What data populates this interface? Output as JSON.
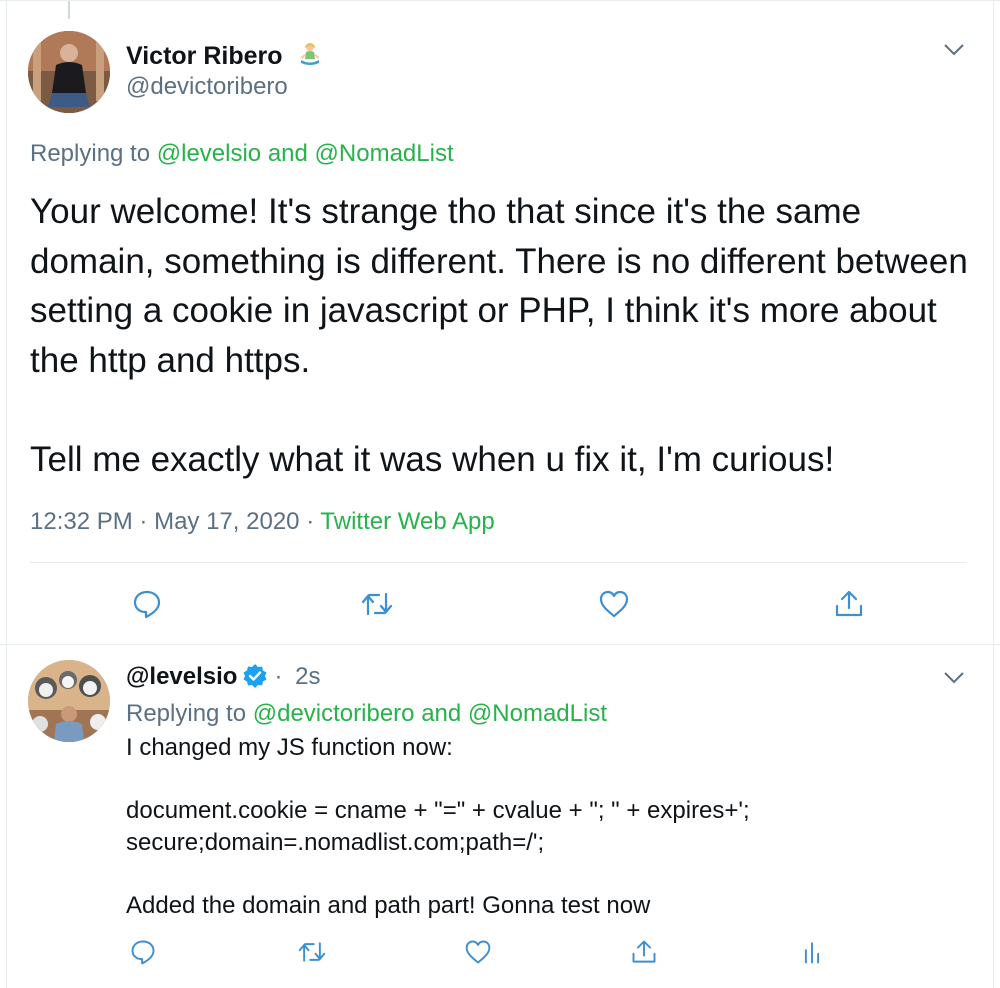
{
  "main_tweet": {
    "author_name": "Victor Ribero",
    "author_handle": "@devictoribero",
    "replying_prefix": "Replying to",
    "replying_user1": "@levelsio",
    "replying_and": "and",
    "replying_user2": "@NomadList",
    "paragraph1": "Your welcome! It's strange tho that since it's the same domain, something is different. There is no different between setting a cookie in javascript or PHP, I think it's more about the http and https.",
    "paragraph2": "Tell me exactly what it was when u fix it, I'm curious!",
    "time": "12:32 PM",
    "dot": "·",
    "date": "May 17, 2020",
    "source": "Twitter Web App",
    "icons": [
      "reply-icon",
      "retweet-icon",
      "like-icon",
      "share-icon",
      "chevron-down-icon",
      "person-meditating-emoji"
    ]
  },
  "reply_tweet": {
    "author_handle": "@levelsio",
    "dot": "·",
    "time_ago": "2s",
    "replying_prefix": "Replying to",
    "replying_user1": "@devictoribero",
    "replying_and": "and",
    "replying_user2": "@NomadList",
    "line1": "I changed my JS function now:",
    "line2": "document.cookie = cname + \"=\" + cvalue + \"; \" + expires+';",
    "line3": "secure;domain=.nomadlist.com;path=/';",
    "line4": "Added the domain and path part! Gonna test now",
    "icons": [
      "reply-icon",
      "retweet-icon",
      "like-icon",
      "share-icon",
      "analytics-icon",
      "verified-badge-icon",
      "chevron-down-icon"
    ]
  },
  "colors": {
    "link": "#26b34a",
    "secondary_text": "#5b7083",
    "icon": "#3d8fd1",
    "verified": "#1da1f2",
    "border": "#e6ecf0"
  }
}
